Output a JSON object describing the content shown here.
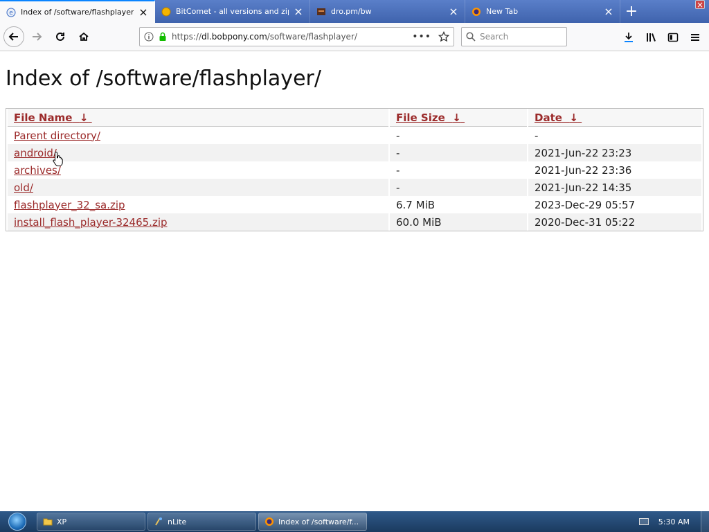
{
  "browser": {
    "tabs": [
      {
        "title": "Index of /software/flashplayer/",
        "icon": "page-icon",
        "active": true
      },
      {
        "title": "BitComet - all versions and zip",
        "icon": "bitcomet-icon",
        "active": false
      },
      {
        "title": "dro.pm/bw",
        "icon": "site-icon",
        "active": false
      },
      {
        "title": "New Tab",
        "icon": "firefox-icon",
        "active": false
      }
    ],
    "url": "https://dl.bobpony.com/software/flashplayer/",
    "search_placeholder": "Search"
  },
  "page": {
    "heading": "Index of /software/flashplayer/",
    "columns": [
      {
        "label": "File Name",
        "sort": "↓"
      },
      {
        "label": "File Size",
        "sort": "↓"
      },
      {
        "label": "Date",
        "sort": "↓"
      }
    ],
    "rows": [
      {
        "name": "Parent directory/",
        "size": "-",
        "date": "-"
      },
      {
        "name": "android/",
        "size": "-",
        "date": "2021-Jun-22 23:23"
      },
      {
        "name": "archives/",
        "size": "-",
        "date": "2021-Jun-22 23:36"
      },
      {
        "name": "old/",
        "size": "-",
        "date": "2021-Jun-22 14:35"
      },
      {
        "name": "flashplayer_32_sa.zip",
        "size": "6.7 MiB",
        "date": "2023-Dec-29 05:57"
      },
      {
        "name": "install_flash_player-32465.zip",
        "size": "60.0 MiB",
        "date": "2020-Dec-31 05:22"
      }
    ],
    "link_color": "#9b2a2a"
  },
  "taskbar": {
    "items": [
      {
        "label": "XP",
        "icon": "folder-icon"
      },
      {
        "label": "nLite",
        "icon": "nlite-icon"
      },
      {
        "label": "Index of /software/f...",
        "icon": "firefox-icon"
      }
    ],
    "clock": "5:30 AM"
  }
}
